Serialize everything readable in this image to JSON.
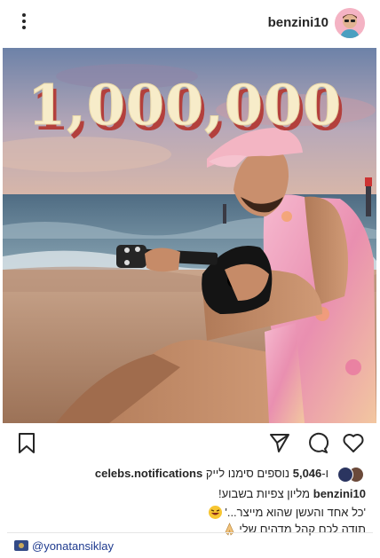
{
  "header": {
    "username": "benzini10",
    "menu_icon": "kebab-menu-icon",
    "avatar_icon": "profile-avatar"
  },
  "post": {
    "overlay_text": "1,000,000",
    "colors": {
      "overlay_text_fill": "#f7ecc9",
      "overlay_text_shadow": "#b3403c",
      "sky": "#8d9ab4",
      "sea": "#5d7f95",
      "sand": "#c49b7b",
      "tank_top": "#f0a7c2",
      "cap": "#f2b3c1"
    }
  },
  "actions": {
    "bookmark_icon": "bookmark-icon",
    "share_icon": "paper-plane-icon",
    "comment_icon": "comment-icon",
    "like_icon": "heart-icon"
  },
  "likes": {
    "prefix": "ו-",
    "count": "5,046",
    "text": "נוספים סימנו לייק",
    "user": "celebs.notifications"
  },
  "caption": {
    "user": "benzini10",
    "line1_text": "מליון צפיות בשבוע!",
    "line2_text": "'כל אחד והעשן שהוא מייצר...'",
    "line3_text": "תודה לכם קהל מדהים שלי",
    "emoji_laugh": "laughing-emoji",
    "emoji_pray": "praying-hands-emoji"
  },
  "credit": {
    "text": "@yonatansiklay",
    "icon": "camera-emoji"
  }
}
